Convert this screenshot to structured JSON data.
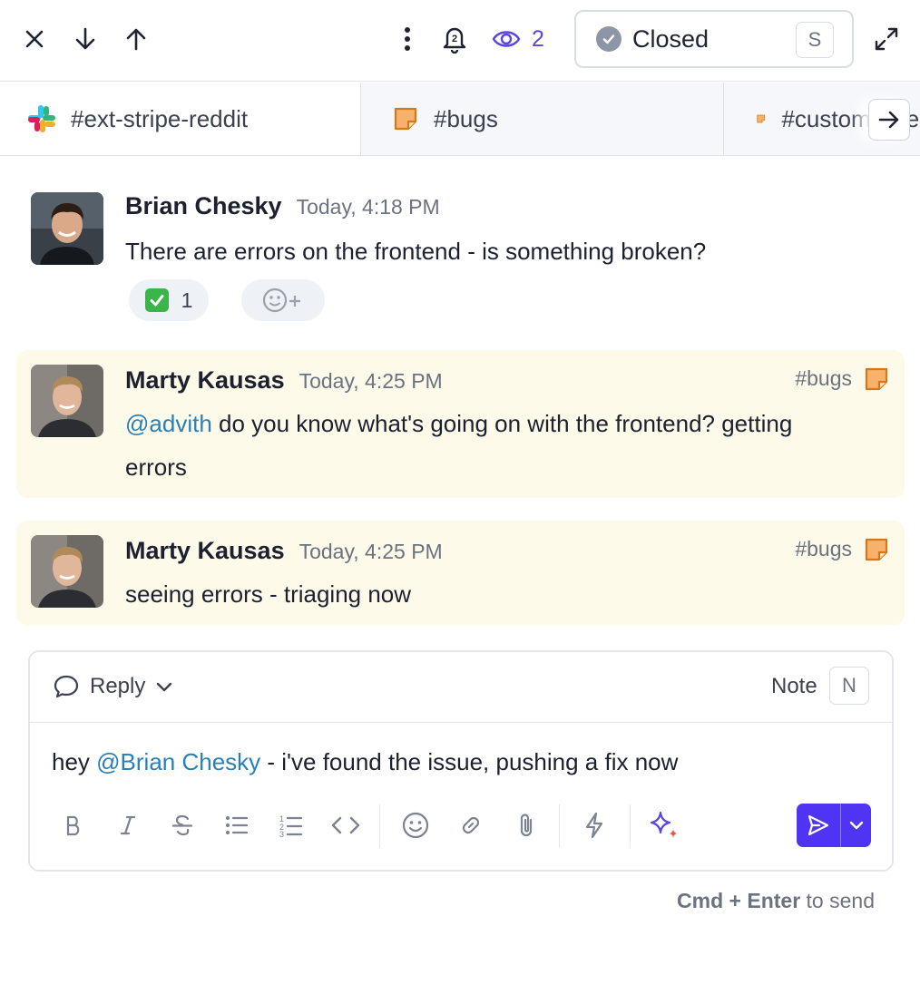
{
  "toolbar": {
    "watchers_count": "2",
    "status": {
      "label": "Closed",
      "shortcut": "S"
    }
  },
  "tabs": [
    {
      "label": "#ext-stripe-reddit",
      "icon": "slack-icon"
    },
    {
      "label": "#bugs",
      "icon": "note-icon"
    },
    {
      "label": "#customer-feedback",
      "icon": "note-icon"
    }
  ],
  "messages": [
    {
      "author": "Brian Chesky",
      "time": "Today, 4:18 PM",
      "text": "There are errors on the frontend - is something broken?",
      "reactions": [
        {
          "emoji": "✅",
          "count": "1"
        }
      ]
    },
    {
      "author": "Marty Kausas",
      "time": "Today, 4:25 PM",
      "channel": "#bugs",
      "mention": "@advith",
      "text_line1": " do you know what's going on with the frontend? getting",
      "text_line2": "errors"
    },
    {
      "author": "Marty Kausas",
      "time": "Today, 4:25 PM",
      "channel": "#bugs",
      "text": "seeing errors - triaging now"
    }
  ],
  "composer": {
    "mode_label": "Reply",
    "note_label": "Note",
    "note_shortcut": "N",
    "draft_prefix": "hey ",
    "draft_mention": "@Brian Chesky",
    "draft_suffix": " - i've found the issue, pushing a fix now"
  },
  "hint": {
    "keys": "Cmd + Enter",
    "suffix": " to send"
  },
  "colors": {
    "accent": "#4f35f3",
    "mention": "#2980b9",
    "highlight_bg": "#fdfae9",
    "watch": "#5b45e0"
  }
}
